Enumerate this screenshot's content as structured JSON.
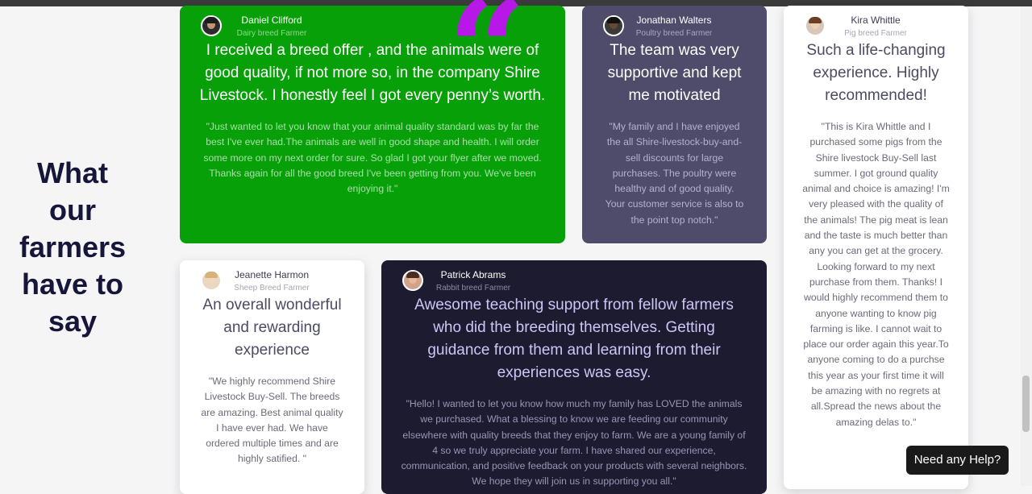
{
  "section": {
    "heading": "What our farmers have to say",
    "heading_lines": [
      "What",
      "our",
      "farmers",
      "have to",
      "say"
    ]
  },
  "testimonials": [
    {
      "name": "Daniel Clifford",
      "role": "Dairy breed Farmer",
      "headline": "I received a breed offer , and the animals were of good quality, if not more so, in the company Shire Livestock. I honestly feel I got every penny’s worth.",
      "body": "\"Just wanted to let you know that your animal quality standard was by far the best I've ever had.The animals are well in good shape and health. I will order some more on my next order for sure. So glad I got your flyer after we moved. Thanks again for all the good breed I've been getting from you. We've been enjoying it.\"",
      "bg_color": "#07a008"
    },
    {
      "name": "Jonathan Walters",
      "role": "Poultry breed Farmer",
      "headline": "The team was very supportive and kept me motivated",
      "body": "\"My family and I have enjoyed the all Shire-livestock-buy-and-sell discounts for large purchases. The poultry were healthy and of good quality. Your customer service is also to the point top notch.\"",
      "bg_color": "#4e4b6b"
    },
    {
      "name": "Kira Whittle",
      "role": "Pig breed Farmer",
      "headline": "Such a life-changing experience. Highly recommended!",
      "body": "\"This is Kira Whittle and I purchased some pigs from the Shire livestock Buy-Sell last summer. I got ground quality animal and choice is amazing! I'm very pleased with the quality of the animals! The pig meat is lean and the taste is much better than any you can get at the grocery. Looking forward to my next purchase from them. Thanks! I would highly recommend them to anyone wanting to know pig farming is like. I cannot wait to place our order again this year.To anyone coming to do a purchse this year as your first time it will be amazing with no regrets at all.Spread the news about the amazing delas to.\"",
      "bg_color": "#ffffff"
    },
    {
      "name": "Jeanette Harmon",
      "role": "Sheep Breed Farmer",
      "headline": "An overall wonderful and rewarding experience",
      "body": "\"We highly recommend Shire Livestock Buy-Sell. The breeds are amazing. Best animal quality I have ever had. We have ordered multiple times and are highly satified. \"",
      "bg_color": "#ffffff"
    },
    {
      "name": "Patrick Abrams",
      "role": "Rabbit breed Farmer",
      "headline": "Awesome teaching support from fellow farmers who did the breeding themselves. Getting guidance from them and learning from their experiences was easy.",
      "body": "\"Hello! I wanted to let you know how much my family has LOVED the animals we purchased. What a blessing to know we are feeding our community elsewhere with quality breeds that they enjoy to farm. We are a young family of 4 so we truly appreciate your farm. I have shared our experience, communication, and positive feedback on your products with several neighbors. We hope they will join us in supporting you all.\"",
      "bg_color": "#1d1b30"
    }
  ],
  "quote_glyph": "“",
  "help_button": {
    "label": "Need any Help?"
  },
  "colors": {
    "heading": "#16163a",
    "quote_accent": "#b718e8",
    "purple_headline": "#ffffff",
    "dark_headline": "#cfc5f5"
  },
  "icons": [
    "avatar-daniel",
    "avatar-jonathan",
    "avatar-kira",
    "avatar-jeanette",
    "avatar-patrick",
    "quote-mark-icon"
  ]
}
